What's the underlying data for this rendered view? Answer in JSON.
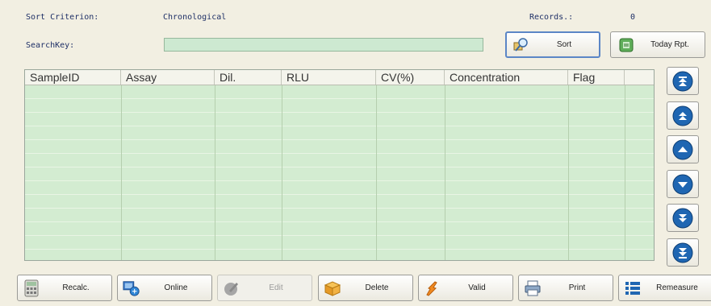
{
  "header": {
    "sort_label": "Sort Criterion:",
    "sort_value": "Chronological",
    "records_label": "Records.:",
    "records_value": "0",
    "search_label": "SearchKey:",
    "search_value": ""
  },
  "toolbar": {
    "sort_label": "Sort",
    "today_label": "Today Rpt."
  },
  "table": {
    "columns": [
      "SampleID",
      "Assay",
      "Dil.",
      "RLU",
      "CV(%)",
      "Concentration",
      "Flag"
    ],
    "rows": []
  },
  "scroll_rail": [
    "scroll-top",
    "page-up",
    "line-up",
    "line-down",
    "page-down",
    "scroll-bottom"
  ],
  "actions": {
    "recalc": "Recalc.",
    "online": "Online",
    "edit": "Edit",
    "delete": "Delete",
    "valid": "Valid",
    "print": "Print",
    "remeasure": "Remeasure"
  },
  "colors": {
    "window_bg": "#f2efe2",
    "grid_bg": "#cfeac8",
    "search_bg": "#cde9d1",
    "accent_blue": "#1f66b2",
    "label_blue": "#1e2f66"
  }
}
